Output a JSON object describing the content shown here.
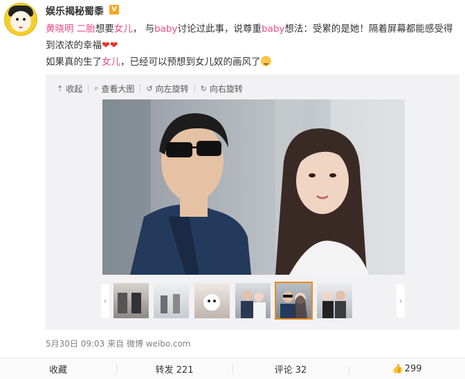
{
  "post": {
    "username": "娱乐揭秘蜀黍",
    "verified_badge": "V",
    "text": {
      "l1_name1": "黄晓明",
      "l1_name2": "二胎",
      "l1_t1": "想要",
      "l1_hl1": "女儿",
      "l1_t2": "， 与",
      "l1_hl2": "baby",
      "l1_t3": "讨论过此事，说尊重",
      "l1_hl3": "baby",
      "l1_t4": "想法：受累的是她！隔着屏幕都能感受得",
      "l2_t1": "到浓浓的幸福",
      "l3_t1": "如果真的生了",
      "l3_hl1": "女儿",
      "l3_t2": "，已经可以预想到女儿奴的画风了"
    },
    "emoji": {
      "hearts": "❤❤"
    },
    "colors": {
      "highlight": "#e84c86",
      "heart": "#e8342c",
      "active_thumb": "#f08a1a"
    }
  },
  "media": {
    "toolbar": {
      "collapse_label": "收起",
      "view_large_label": "查看大图",
      "rotate_left_label": "向左旋转",
      "rotate_right_label": "向右旋转"
    },
    "thumbnails_count": 6,
    "active_thumbnail_index": 5
  },
  "meta": {
    "timestamp": "5月30日 09:03",
    "source": "来自 微博 weibo.com"
  },
  "actions": {
    "favorite_label": "收藏",
    "repost_label": "转发 221",
    "comment_label": "评论 32",
    "like_count": "299"
  }
}
